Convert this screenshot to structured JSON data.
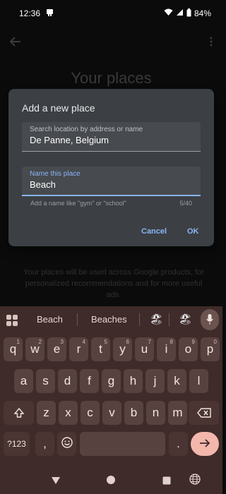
{
  "status_bar": {
    "time": "12:36",
    "battery": "84%",
    "icons": [
      "notification-app-icon",
      "wifi-icon",
      "signal-icon",
      "battery-icon"
    ]
  },
  "background_page": {
    "title": "Your places",
    "footer_note": "Your places will be used across Google products, for personalized recommendations and for more useful ads."
  },
  "dialog": {
    "title": "Add a new place",
    "location_field": {
      "label": "Search location by address or name",
      "value": "De Panne, Belgium"
    },
    "name_field": {
      "label": "Name this place",
      "value": "Beach",
      "helper": "Add a name like \"gym\" or \"school\"",
      "counter": "5/40"
    },
    "cancel_label": "Cancel",
    "ok_label": "OK",
    "accent_color": "#8ab4f8"
  },
  "keyboard": {
    "suggestions": [
      "Beach",
      "Beaches"
    ],
    "emoji_suggestions": [
      "🏖",
      "🏖"
    ],
    "rows": [
      [
        {
          "k": "q",
          "s": "1"
        },
        {
          "k": "w",
          "s": "2"
        },
        {
          "k": "e",
          "s": "3"
        },
        {
          "k": "r",
          "s": "4"
        },
        {
          "k": "t",
          "s": "5"
        },
        {
          "k": "y",
          "s": "6"
        },
        {
          "k": "u",
          "s": "7"
        },
        {
          "k": "i",
          "s": "8"
        },
        {
          "k": "o",
          "s": "9"
        },
        {
          "k": "p",
          "s": "0"
        }
      ],
      [
        {
          "k": "a"
        },
        {
          "k": "s"
        },
        {
          "k": "d"
        },
        {
          "k": "f"
        },
        {
          "k": "g"
        },
        {
          "k": "h"
        },
        {
          "k": "j"
        },
        {
          "k": "k"
        },
        {
          "k": "l"
        }
      ],
      [
        {
          "k": "z"
        },
        {
          "k": "x"
        },
        {
          "k": "c"
        },
        {
          "k": "v"
        },
        {
          "k": "b"
        },
        {
          "k": "n"
        },
        {
          "k": "m"
        }
      ]
    ],
    "symbols_label": "?123",
    "comma_label": ",",
    "period_label": ".",
    "key_color": "#584240",
    "background_color": "#3f2b29"
  }
}
